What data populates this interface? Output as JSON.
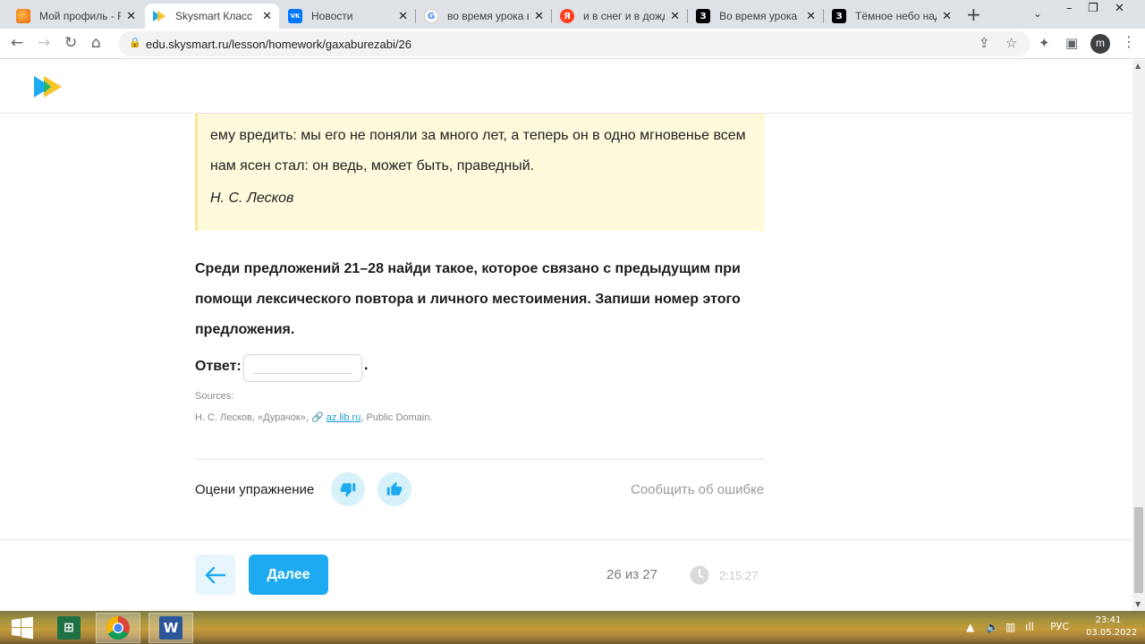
{
  "browser": {
    "tabs": [
      {
        "title": "Мой профиль - Fa",
        "favicon": "firefox-fox-icon",
        "color": "#e66000",
        "glyph": ""
      },
      {
        "title": "Skysmart Класс",
        "favicon": "skysmart-icon",
        "color": "#1eaaf1",
        "glyph": "",
        "active": true
      },
      {
        "title": "Новости",
        "favicon": "vk-icon",
        "color": "#0077ff",
        "glyph": "VK"
      },
      {
        "title": "во время урока в",
        "favicon": "google-icon",
        "color": "#ffffff",
        "glyph": "G"
      },
      {
        "title": "и в снег и в дожд",
        "favicon": "yandex-icon",
        "color": "#fc3f1d",
        "glyph": "Я"
      },
      {
        "title": "Во время урока в",
        "favicon": "znanija-icon",
        "color": "#000000",
        "glyph": "З"
      },
      {
        "title": "Тёмное небо над",
        "favicon": "znanija-icon",
        "color": "#000000",
        "glyph": "З"
      }
    ],
    "url": "edu.skysmart.ru/lesson/homework/gaxaburezabi/26",
    "profile_initial": "m"
  },
  "quote": {
    "text": "ему вредить: мы его не поняли за много лет, а теперь он в одно мгновенье всем нам ясен стал: он ведь, может быть, праведный.",
    "author": "Н. С. Лесков"
  },
  "task": {
    "question": "Среди предложений 21–28 найди такое, которое связано с предыдущим при помощи лексического повтора и личного местоимения. Запиши номер этого предложения.",
    "answer_label": "Ответ:",
    "answer_value": "",
    "answer_suffix": "."
  },
  "sources": {
    "label": "Sources:",
    "citation": "Н. С. Лесков, «Дурачок», ",
    "link_text": "az.lib.ru",
    "license": ", Public Domain."
  },
  "rating": {
    "label": "Оцени упражнение",
    "report": "Сообщить об ошибке"
  },
  "footer": {
    "next_label": "Далее",
    "progress": "26 из 27",
    "timer": "2:15:27"
  },
  "taskbar": {
    "language": "РУС",
    "time": "23:41",
    "date": "03.05.2022"
  },
  "colors": {
    "accent": "#1eaaf1",
    "quote_bg": "#fefadb",
    "rate_bg": "#d6f1fa"
  }
}
